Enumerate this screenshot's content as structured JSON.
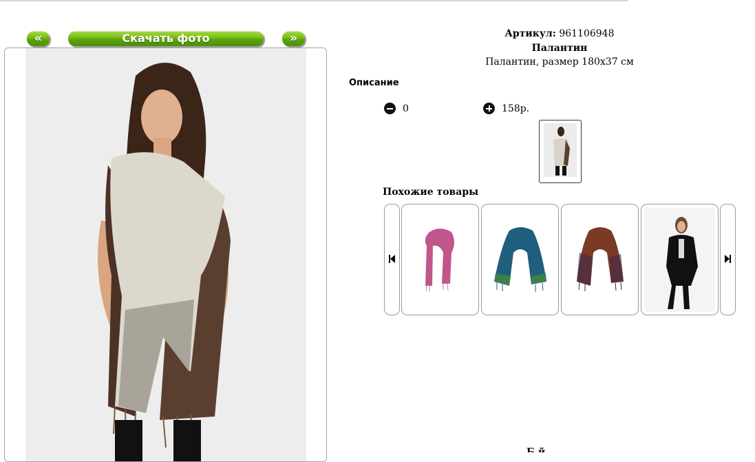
{
  "gallery": {
    "prev_label": "«",
    "next_label": "»",
    "download_label": "Скачать фото"
  },
  "product": {
    "sku_label": "Артикул:",
    "sku_value": "961106948",
    "name": "Палантин",
    "full_name": "Палантин, размер 180х37 см",
    "description_heading": "Описание",
    "quantity": "0",
    "price": "158р."
  },
  "similar": {
    "heading": "Похожие товары",
    "items": [
      {
        "icon": "pink-scarf-image"
      },
      {
        "icon": "blue-scarf-image"
      },
      {
        "icon": "brown-scarf-image"
      },
      {
        "icon": "black-cardigan-model-image"
      }
    ]
  },
  "footer": {
    "partial_text": "Б й"
  },
  "colors": {
    "button_green": "#6cb414",
    "border_gray": "#9a9a9a",
    "thumb_border": "#1e3c5c"
  }
}
